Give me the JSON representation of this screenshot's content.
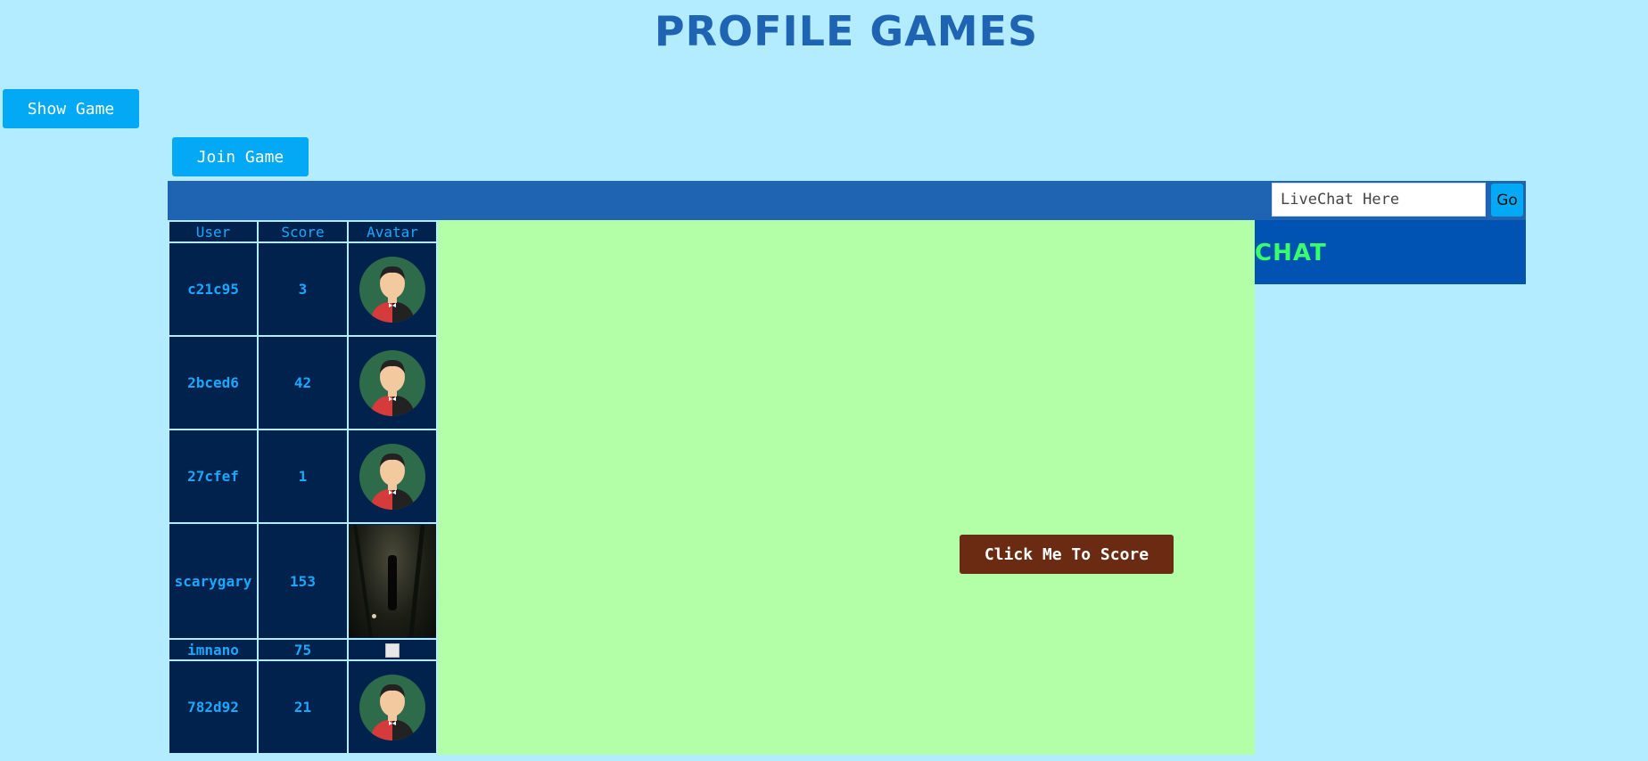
{
  "header": {
    "title": "Profile Games"
  },
  "controls": {
    "show_game_label": "Show Game",
    "join_game_label": "Join Game"
  },
  "chat": {
    "input_placeholder": "LiveChat Here",
    "go_label": "Go",
    "panel_title": "Chat"
  },
  "game": {
    "score_button_label": "Click Me To Score"
  },
  "scoreboard": {
    "columns": [
      "User",
      "Score",
      "Avatar"
    ],
    "rows": [
      {
        "user": "c21c95",
        "score": "3",
        "avatar": "default-avatar-icon"
      },
      {
        "user": "2bced6",
        "score": "42",
        "avatar": "default-avatar-icon"
      },
      {
        "user": "27cfef",
        "score": "1",
        "avatar": "default-avatar-icon"
      },
      {
        "user": "scarygary",
        "score": "153",
        "avatar": "dark-forest-photo"
      },
      {
        "user": "imnano",
        "score": "75",
        "avatar": "broken-image-icon"
      },
      {
        "user": "782d92",
        "score": "21",
        "avatar": "default-avatar-icon"
      }
    ]
  },
  "colors": {
    "background": "#b3ecff",
    "title": "#1f63b3",
    "button": "#03a9f4",
    "game_area": "#b3ffa8",
    "score_button": "#6b2a12",
    "chat_panel": "#0052b3",
    "chat_title": "#39ff6a",
    "table_cell": "#00224d",
    "table_text": "#1aa8ff"
  }
}
